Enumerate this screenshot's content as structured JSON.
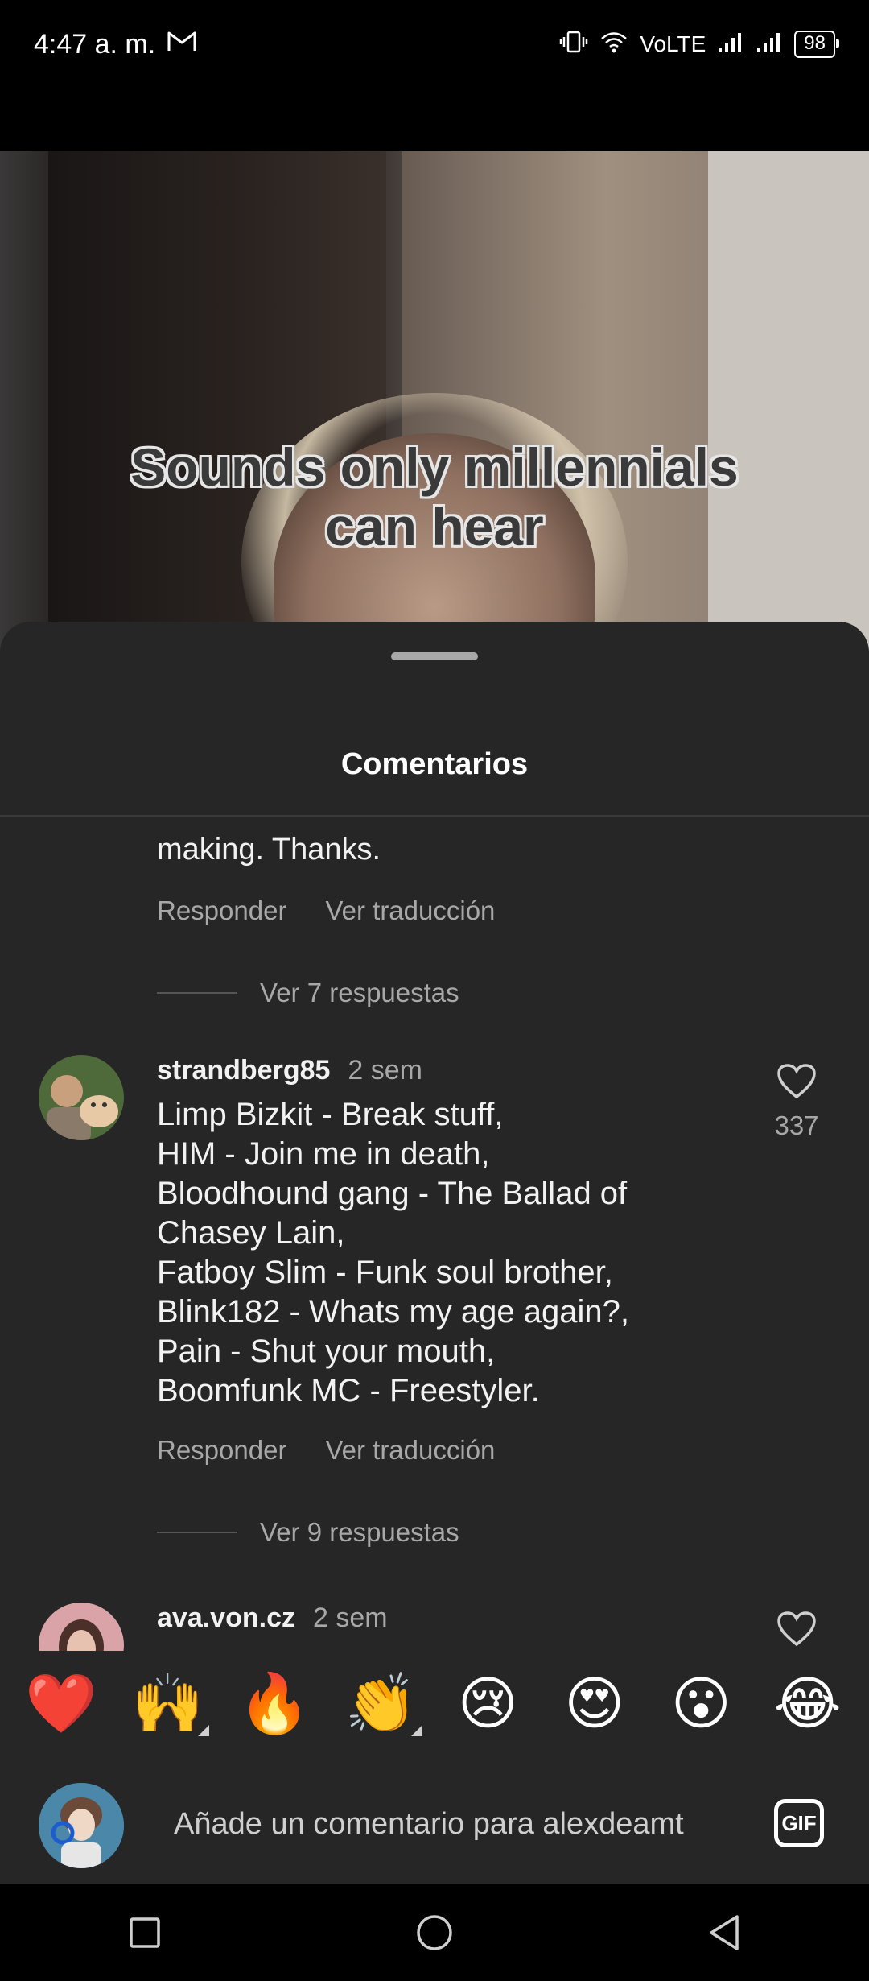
{
  "status_bar": {
    "time": "4:47 a. m.",
    "network": "VoLTE",
    "battery": "98",
    "mail_icon": "gmail-icon"
  },
  "video": {
    "caption_line1": "Sounds only millennials",
    "caption_line2": "can hear"
  },
  "sheet": {
    "title": "Comentarios"
  },
  "comments": [
    {
      "partial_text": "making. Thanks.",
      "reply_label": "Responder",
      "translate_label": "Ver traducción",
      "replies_label": "Ver 7 respuestas"
    },
    {
      "username": "strandberg85",
      "time": "2 sem",
      "text": "Limp Bizkit - Break stuff,\nHIM - Join me in death,\nBloodhound gang - The Ballad of Chasey Lain,\nFatboy Slim - Funk soul brother,\nBlink182 - Whats my age again?,\nPain - Shut your mouth,\nBoomfunk MC - Freestyler.",
      "likes": "337",
      "reply_label": "Responder",
      "translate_label": "Ver traducción",
      "replies_label": "Ver 9 respuestas"
    },
    {
      "username": "ava.von.cz",
      "time": "2 sem"
    }
  ],
  "emoji_bar": [
    "❤️",
    "🙌",
    "🔥",
    "👏",
    "😢",
    "😍",
    "😮",
    "😂"
  ],
  "input": {
    "placeholder": "Añade un comentario para alexdeamt",
    "gif_label": "GIF"
  },
  "colors": {
    "sheet_bg": "#262626",
    "muted_text": "#a8a8a8",
    "primary_text": "#f2f2f2"
  }
}
